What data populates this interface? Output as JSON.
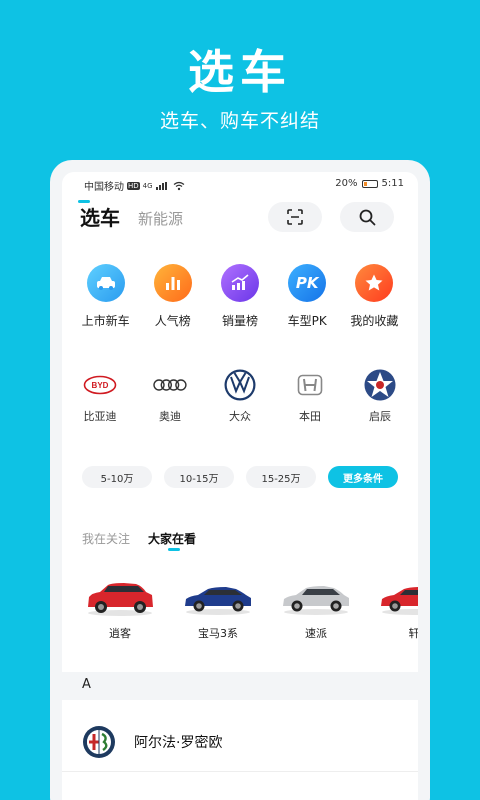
{
  "promo": {
    "title": "选车",
    "subtitle": "选车、购车不纠结"
  },
  "statusbar": {
    "carrier": "中国移动",
    "hd": "HD",
    "network": "4G",
    "battery": "20%",
    "time": "5:11"
  },
  "tabs": [
    {
      "label": "选车",
      "active": true
    },
    {
      "label": "新能源",
      "active": false
    }
  ],
  "top_buttons": {
    "scan": "scan-icon",
    "search": "search-icon"
  },
  "functions": [
    {
      "label": "上市新车",
      "icon": "new-car-icon",
      "color": "#39B7F2"
    },
    {
      "label": "人气榜",
      "icon": "bar-chart-icon",
      "color": "#FF8A1F"
    },
    {
      "label": "销量榜",
      "icon": "sales-trend-icon",
      "color": "#8B4DF0"
    },
    {
      "label": "车型PK",
      "icon": "pk-icon",
      "color": "#1E8FF5",
      "icon_text": "PK"
    },
    {
      "label": "我的收藏",
      "icon": "star-icon",
      "color": "#FF5A24"
    }
  ],
  "brands": [
    {
      "label": "比亚迪",
      "logo": "byd-logo-icon"
    },
    {
      "label": "奥迪",
      "logo": "audi-logo-icon"
    },
    {
      "label": "大众",
      "logo": "volkswagen-logo-icon"
    },
    {
      "label": "本田",
      "logo": "honda-logo-icon"
    },
    {
      "label": "启辰",
      "logo": "venucia-logo-icon"
    }
  ],
  "price_filters": [
    "5-10万",
    "10-15万",
    "15-25万"
  ],
  "more_filters": "更多条件",
  "subtabs": [
    {
      "label": "我在关注",
      "active": false
    },
    {
      "label": "大家在看",
      "active": true
    }
  ],
  "cars": [
    {
      "label": "逍客",
      "color": "#D8262C"
    },
    {
      "label": "宝马3系",
      "color": "#1F3C8C"
    },
    {
      "label": "速派",
      "color": "#C7C9CC"
    },
    {
      "label": "轩",
      "color": "#D8262C"
    }
  ],
  "brand_list": {
    "section": "A",
    "items": [
      {
        "label": "阿尔法·罗密欧",
        "logo": "alfa-romeo-logo-icon"
      }
    ]
  }
}
